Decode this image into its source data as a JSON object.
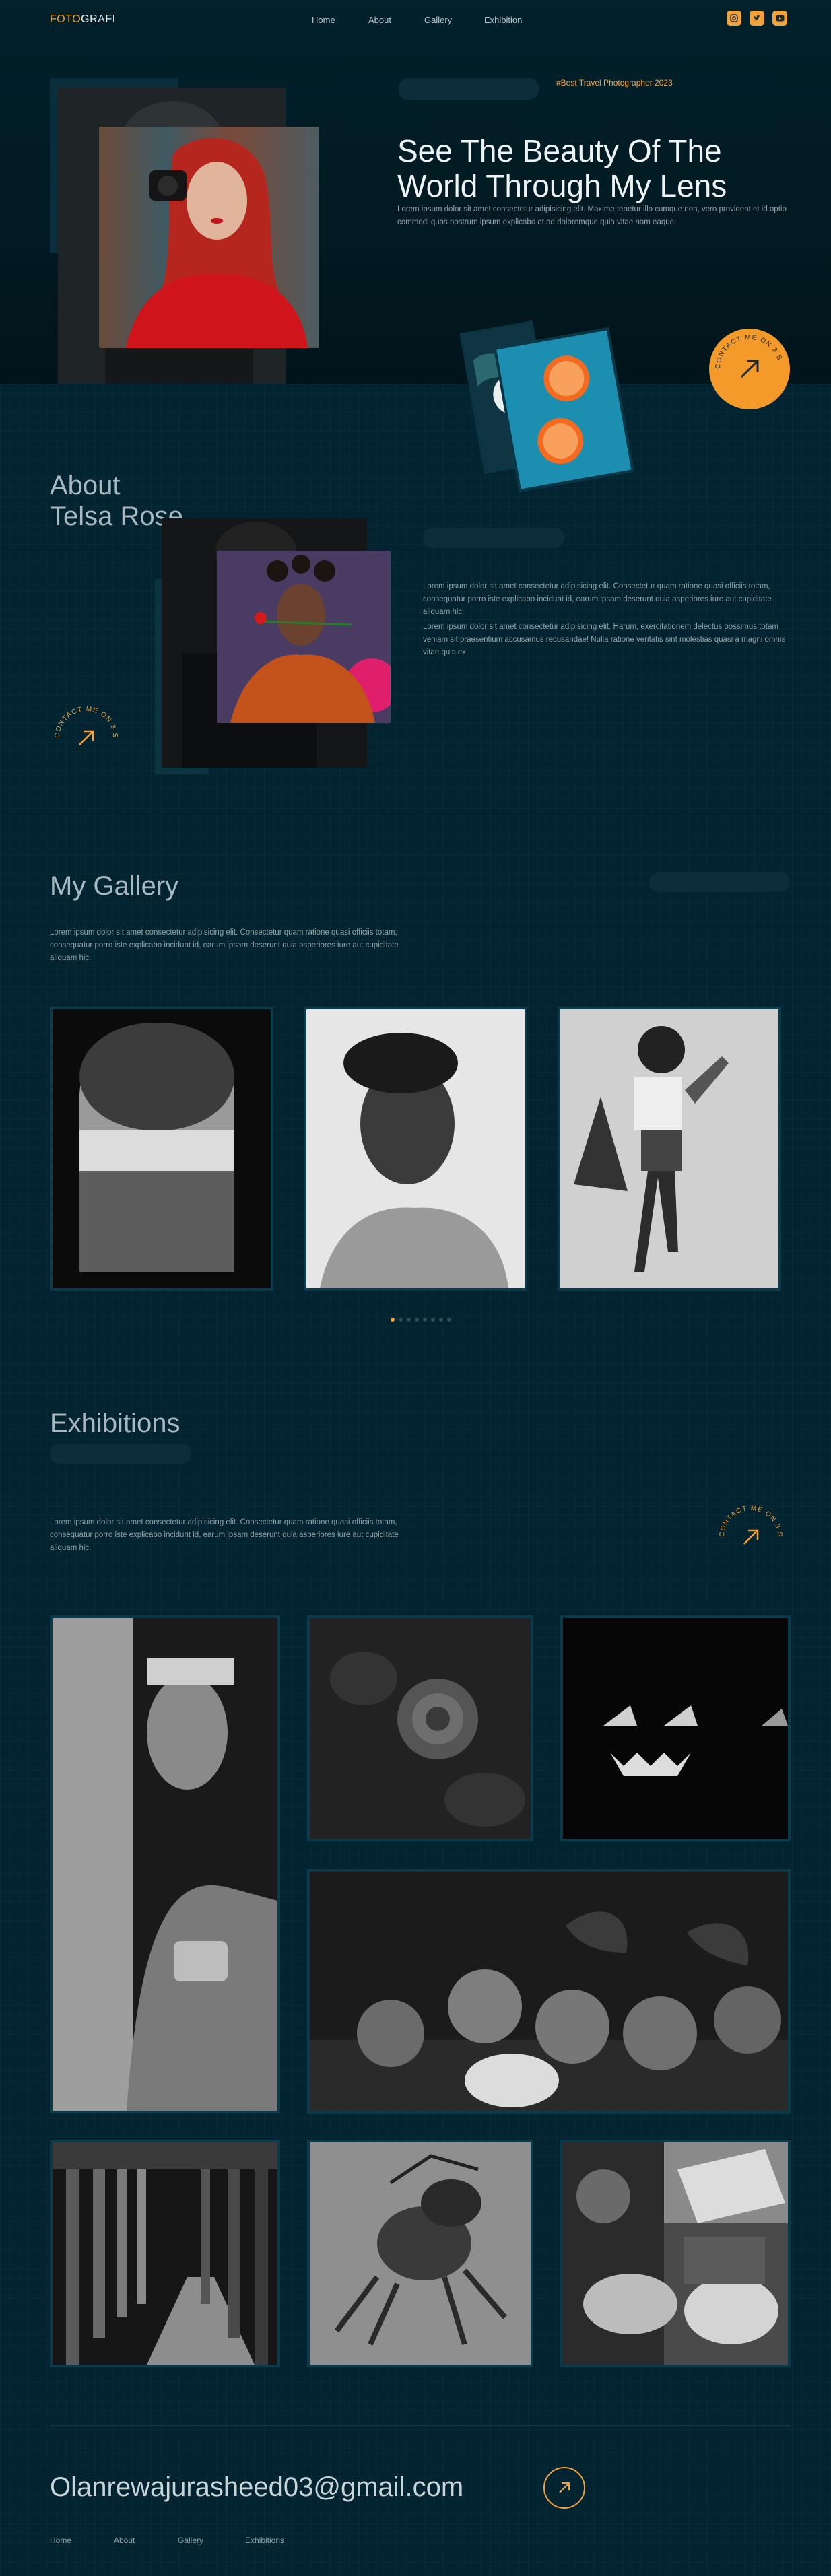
{
  "brand": {
    "part1": "FOTO",
    "part2": "GRAFI"
  },
  "nav": {
    "items": [
      "Home",
      "About",
      "Gallery",
      "Exhibition"
    ]
  },
  "social": [
    "instagram-icon",
    "twitter-icon",
    "youtube-icon"
  ],
  "hero": {
    "badge": "#Best Travel Photographer 2023",
    "title_line1": "See The Beauty Of The",
    "title_line2": "World Through My Lens",
    "text": "Lorem ipsum dolor sit amet consectetur adipisicing elit. Maxime tenetur illo cumque non, vero provident et id optio commodi quas nostrum ipsum explicabo et ad doloremque quia vitae nam eaque!"
  },
  "contact_badge": {
    "arc_text": "CONTACT ME ON 3 S",
    "arrow": "↗"
  },
  "about": {
    "title_line1": "About",
    "title_line2": "Telsa Rose",
    "text1": "Lorem ipsum dolor sit amet consectetur adipisicing elit. Consectetur quam ratione quasi officiis totam, consequatur porro iste explicabo incidunt id, earum ipsam deserunt quia asperiores iure aut cupiditate aliquam hic.",
    "text2": "Lorem ipsum dolor sit amet consectetur adipisicing elit. Harum, exercitationem delectus possimus totam veniam sit praesentium accusamus recusandae! Nulla ratione veritatis sint molestias quasi a magni omnis vitae quis ex!"
  },
  "gallery": {
    "title": "My Gallery",
    "text": "Lorem ipsum dolor sit amet consectetur adipisicing elit. Consectetur quam ratione quasi officiis totam, consequatur porro iste explicabo incidunt id, earum ipsam deserunt quia asperiores iure aut cupiditate aliquam hic.",
    "photos": [
      "airplane-window-photo",
      "man-portrait-photo",
      "woman-dancing-photo"
    ],
    "pager_total": 8,
    "pager_active": 1
  },
  "exhibitions": {
    "title": "Exhibitions",
    "text": "Lorem ipsum dolor sit amet consectetur adipisicing elit. Consectetur quam ratione quasi officiis totam, consequatur porro iste explicabo incidunt id, earum ipsam deserunt quia asperiores iure aut cupiditate aliquam hic."
  },
  "footer": {
    "email": "Olanrewajurasheed03@gmail.com",
    "nav": [
      "Home",
      "About",
      "Gallery",
      "Exhibitions"
    ]
  },
  "colors": {
    "accent": "#f2a23a",
    "background": "#022430",
    "card": "#0d3a4a"
  }
}
